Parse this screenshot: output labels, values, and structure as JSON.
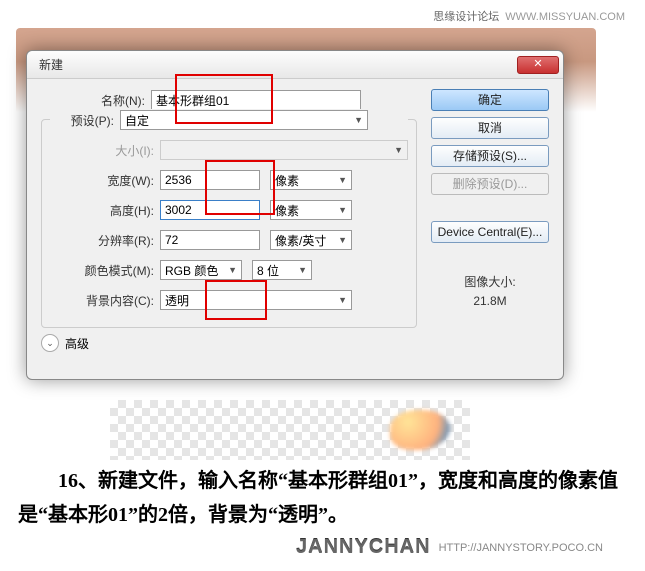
{
  "watermark": {
    "cn": "思缘设计论坛",
    "url": "WWW.MISSYUAN.COM"
  },
  "dialog": {
    "title": "新建",
    "labels": {
      "name": "名称(N):",
      "preset": "预设(P):",
      "size": "大小(I):",
      "width": "宽度(W):",
      "height": "高度(H):",
      "resolution": "分辨率(R):",
      "color_mode": "颜色模式(M):",
      "background": "背景内容(C):",
      "advanced": "高级",
      "image_size_label": "图像大小:",
      "image_size_value": "21.8M"
    },
    "values": {
      "name": "基本形群组01",
      "preset": "自定",
      "width": "2536",
      "height": "3002",
      "resolution": "72",
      "color_mode": "RGB 颜色",
      "bit_depth": "8 位",
      "background": "透明"
    },
    "units": {
      "width": "像素",
      "height": "像素",
      "resolution": "像素/英寸"
    },
    "buttons": {
      "ok": "确定",
      "cancel": "取消",
      "save_preset": "存储预设(S)...",
      "delete_preset": "删除预设(D)...",
      "device_central": "Device Central(E)..."
    }
  },
  "instruction": "　　16、新建文件，输入名称“基本形群组01”，宽度和高度的像素值是“基本形01”的2倍，背景为“透明”。",
  "signature": {
    "logo": "JANNYCHAN",
    "url": "HTTP://JANNYSTORY.POCO.CN"
  }
}
